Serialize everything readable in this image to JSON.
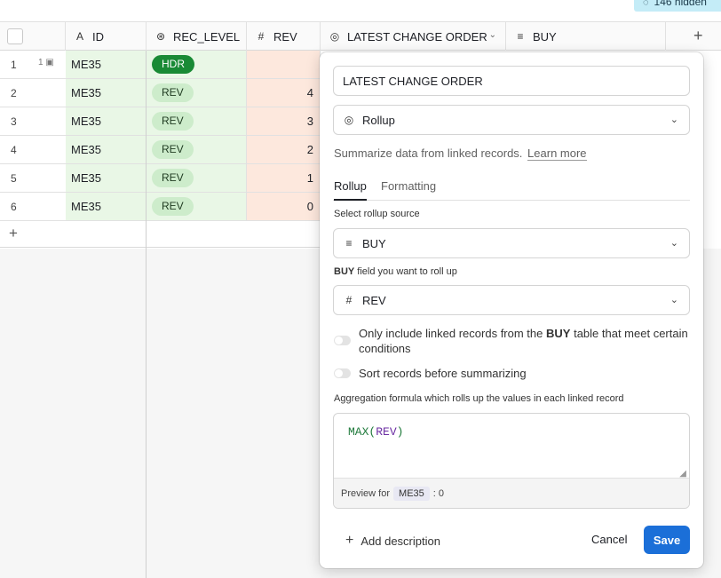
{
  "top": {
    "hidden_fields": "146 hidden"
  },
  "grid": {
    "columns": [
      {
        "name": "ID",
        "icon": "text-field-icon"
      },
      {
        "name": "REC_LEVEL",
        "icon": "single-select-icon"
      },
      {
        "name": "REV",
        "icon": "number-field-icon"
      },
      {
        "name": "LATEST CHANGE ORDER",
        "icon": "rollup-icon"
      },
      {
        "name": "BUY",
        "icon": "linked-record-icon"
      }
    ],
    "rows": [
      {
        "num": "1",
        "comments": "1",
        "id": "ME35",
        "rec_level": "HDR",
        "rev": ""
      },
      {
        "num": "2",
        "comments": "",
        "id": "ME35",
        "rec_level": "REV",
        "rev": "4"
      },
      {
        "num": "3",
        "comments": "",
        "id": "ME35",
        "rec_level": "REV",
        "rev": "3"
      },
      {
        "num": "4",
        "comments": "",
        "id": "ME35",
        "rec_level": "REV",
        "rev": "2"
      },
      {
        "num": "5",
        "comments": "",
        "id": "ME35",
        "rec_level": "REV",
        "rev": "1"
      },
      {
        "num": "6",
        "comments": "",
        "id": "ME35",
        "rec_level": "REV",
        "rev": "0"
      }
    ]
  },
  "popover": {
    "field_name": "LATEST CHANGE ORDER",
    "field_type": "Rollup",
    "description": "Summarize data from linked records.",
    "learn_more": "Learn more",
    "tabs": [
      "Rollup",
      "Formatting"
    ],
    "source_label": "Select rollup source",
    "source_value": "BUY",
    "rollup_field_label_table": "BUY",
    "rollup_field_label_rest": "field you want to roll up",
    "rollup_field_value": "REV",
    "toggle1_pre": "Only include linked records from the",
    "toggle1_table": "BUY",
    "toggle1_post": "table that meet certain conditions",
    "toggle2": "Sort records before summarizing",
    "formula_label": "Aggregation formula which rolls up the values in each linked record",
    "formula_fn": "MAX(",
    "formula_arg": "REV",
    "formula_close": ")",
    "preview_label": "Preview for",
    "preview_record": "ME35",
    "preview_value": ": 0",
    "add_description": "Add description",
    "cancel": "Cancel",
    "save": "Save"
  },
  "colors": {
    "primary_green_cells": "#e9f7e6",
    "rev_cells": "#fde8dd",
    "hdr_pill": "#198a35",
    "rev_pill": "#cdeccb",
    "save_button": "#1b6fd8",
    "hidden_chip": "#c4ecf7"
  }
}
